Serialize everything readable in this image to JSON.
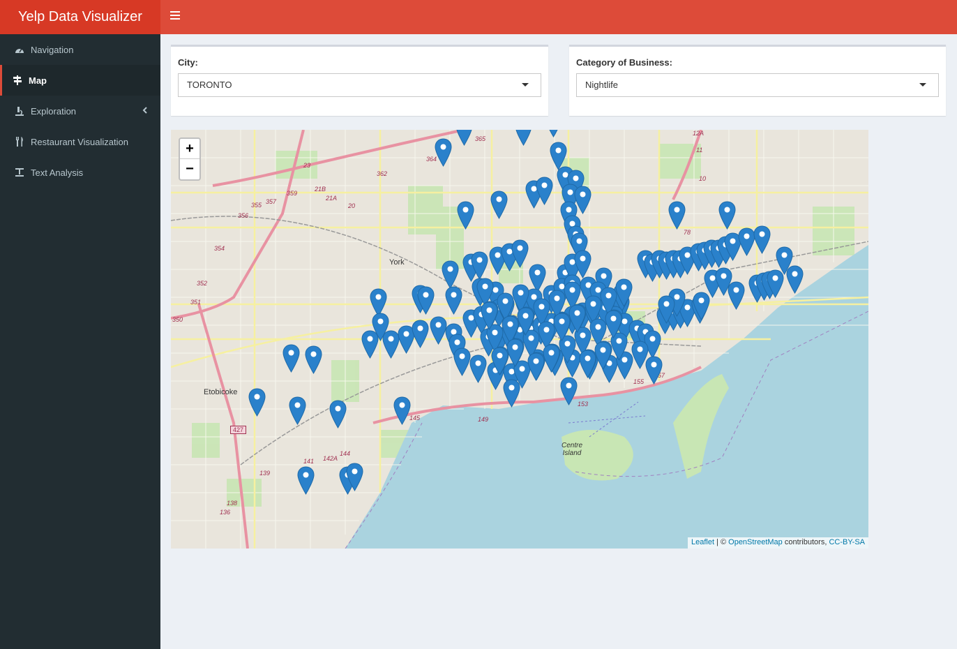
{
  "app": {
    "title": "Yelp Data Visualizer"
  },
  "sidebar": {
    "items": [
      {
        "label": "Navigation",
        "icon": "dashboard-icon"
      },
      {
        "label": "Map",
        "icon": "signpost-icon"
      },
      {
        "label": "Exploration",
        "icon": "microscope-icon"
      },
      {
        "label": "Restaurant Visualization",
        "icon": "cutlery-icon"
      },
      {
        "label": "Text Analysis",
        "icon": "text-icon"
      }
    ],
    "active": "Map"
  },
  "filters": {
    "city_label": "City:",
    "city_value": "TORONTO",
    "category_label": "Category of Business:",
    "category_value": "Nightlife"
  },
  "map": {
    "zoom_in": "+",
    "zoom_out": "−",
    "labels": {
      "york": "York",
      "etobicoke": "Etobicoke",
      "centre_island": "Centre Island"
    },
    "route_labels": [
      "365",
      "362",
      "364",
      "359",
      "357",
      "356",
      "355",
      "354",
      "352",
      "351",
      "350",
      "23",
      "21B",
      "21A",
      "20",
      "10",
      "11",
      "12A",
      "78",
      "145",
      "141",
      "142A",
      "144",
      "139",
      "138",
      "136",
      "149",
      "153",
      "155",
      "157"
    ],
    "highway_shield": "427",
    "attribution": {
      "leaflet": "Leaflet",
      "separator": " | © ",
      "osm": "OpenStreetMap",
      "contributors": " contributors, ",
      "license": "CC-BY-SA"
    },
    "marker_color": "#2a81cb",
    "marker_count": 180
  },
  "colors": {
    "header": "#dd4b39",
    "brand": "#d73925",
    "sidebar": "#222d32",
    "water": "#aad3df",
    "park": "#c8e6b4"
  }
}
